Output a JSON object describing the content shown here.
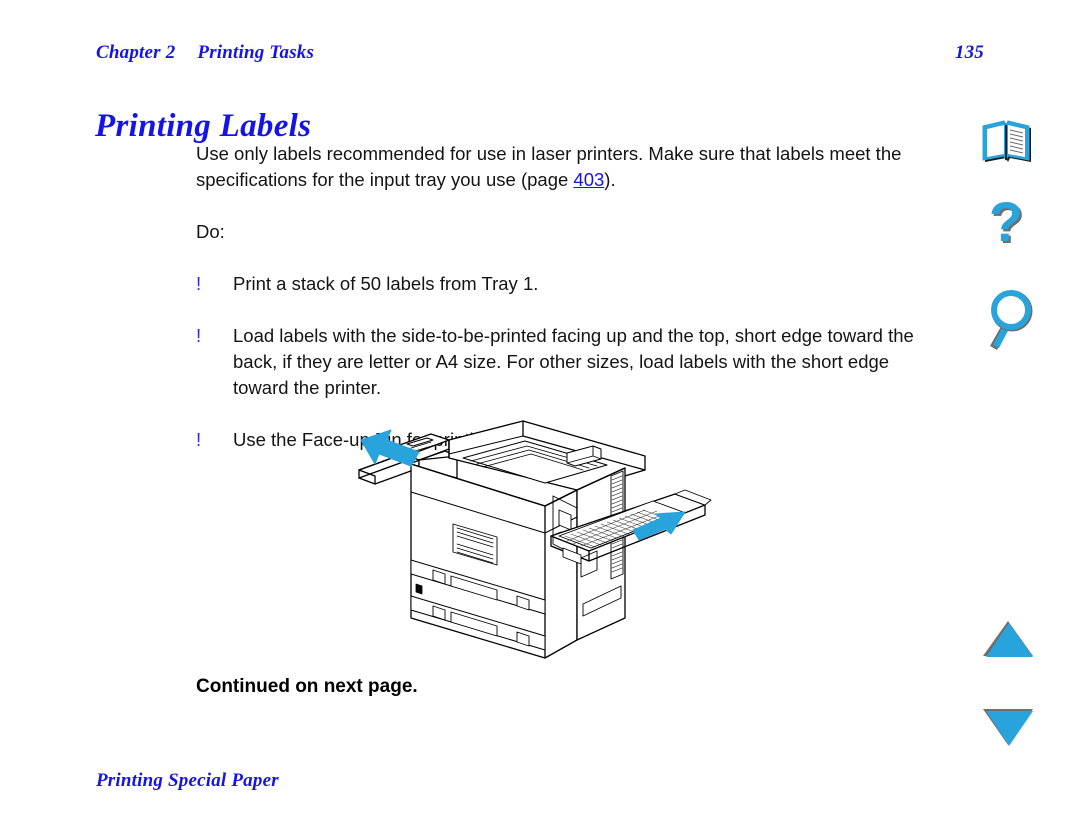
{
  "header": {
    "chapter": "Chapter 2",
    "section": "Printing Tasks",
    "page_number": "135"
  },
  "title": "Printing Labels",
  "body": {
    "intro": "Use only labels recommended for use in laser printers. Make sure that labels meet the specifications for the input tray you use (page ",
    "intro_link": "403",
    "intro_tail": ").",
    "do_label": "Do:",
    "bullet_mark": "!",
    "bullets": [
      "Print a stack of 50 labels from Tray 1.",
      "Load labels with the side-to-be-printed facing up and the top, short edge toward the back, if they are letter or A4 size. For other sizes, load labels with the short edge toward the printer.",
      "Use the Face-up Bin for printing labels."
    ],
    "continued": "Continued on next page."
  },
  "figure": {
    "alt": "Line drawing of a laser printer showing paper exiting the face-up bin on the left and labels being loaded into Tray 1 on the right",
    "arrow_color": "#29a3dc",
    "line_color": "#000000"
  },
  "footer": {
    "text": "Printing Special Paper"
  },
  "nav": {
    "book_label": "Contents",
    "help_label": "Help",
    "search_label": "Search",
    "prev_label": "Previous page",
    "next_label": "Next page"
  },
  "colors": {
    "heading_blue": "#1414e6",
    "link_blue": "#1414e6",
    "icon_cyan": "#29a3dc",
    "icon_shadow": "#6e6e6e",
    "text_black": "#141414"
  }
}
